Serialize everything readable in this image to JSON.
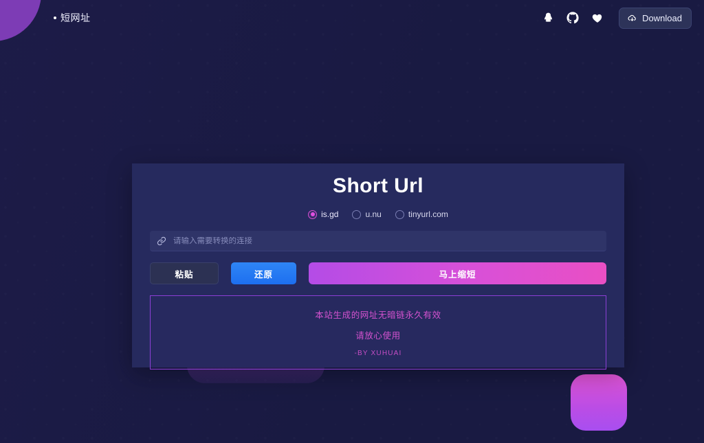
{
  "topbar": {
    "brand": "短网址",
    "icons": [
      {
        "name": "qq-icon",
        "label": "QQ"
      },
      {
        "name": "github-icon",
        "label": "GitHub"
      },
      {
        "name": "heart-icon",
        "label": "Like"
      }
    ],
    "download_label": "Download",
    "download_icon": "cloud-download-icon"
  },
  "card": {
    "title": "Short Url",
    "providers": [
      {
        "label": "is.gd",
        "checked": true
      },
      {
        "label": "u.nu",
        "checked": false
      },
      {
        "label": "tinyurl.com",
        "checked": false
      }
    ],
    "input": {
      "icon": "link-icon",
      "value": "",
      "placeholder": "请输入需要转换的连接"
    },
    "buttons": {
      "paste": "粘贴",
      "restore": "还原",
      "shorten": "马上缩短"
    },
    "notice": {
      "line1": "本站生成的网址无暗链永久有效",
      "line2": "请放心使用",
      "author": "-BY XUHUAI"
    }
  },
  "colors": {
    "page_bg": "#191a42",
    "card_bg": "#262a5e",
    "accent_pink": "#d452cf",
    "accent_purple": "#8d3fd6",
    "blue": "#2f85f5",
    "blob_purple": "#7d3cb5"
  }
}
